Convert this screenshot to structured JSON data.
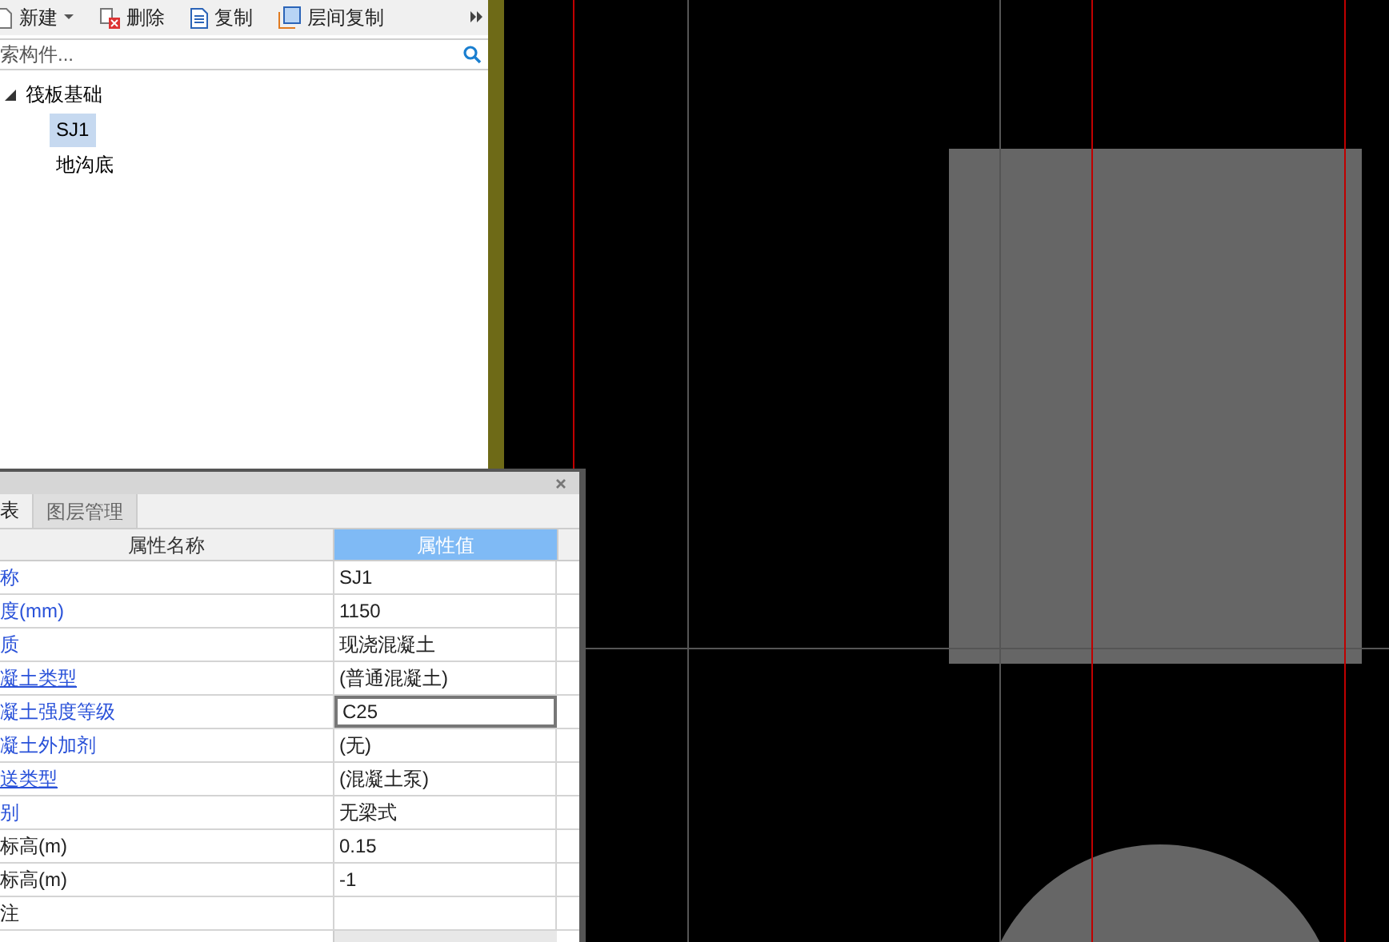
{
  "toolbar": [
    {
      "label": "新建",
      "dropdown": true
    },
    {
      "label": "删除",
      "dropdown": false
    },
    {
      "label": "复制",
      "dropdown": false
    },
    {
      "label": "层间复制",
      "dropdown": false
    }
  ],
  "search": {
    "placeholder": "索构件..."
  },
  "tree": [
    {
      "label": "筏板基础",
      "expanded": true,
      "selected": false,
      "children": [
        {
          "label": "SJ1",
          "selected": true
        },
        {
          "label": "地沟底",
          "selected": false
        }
      ]
    }
  ],
  "properties_panel": {
    "tabs": [
      {
        "label": "表",
        "selected": true
      },
      {
        "label": "图层管理",
        "selected": false
      }
    ],
    "columns": [
      "属性名称",
      "属性值"
    ],
    "rows": [
      {
        "name": "称",
        "value": "SJ1",
        "blue": true,
        "underlined": false,
        "selected": false
      },
      {
        "name": "度(mm)",
        "value": "1150",
        "blue": true,
        "underlined": false,
        "selected": false
      },
      {
        "name": "质",
        "value": "现浇混凝土",
        "blue": true,
        "underlined": false,
        "selected": false
      },
      {
        "name": "凝土类型",
        "value": "(普通混凝土)",
        "blue": true,
        "underlined": true,
        "selected": false
      },
      {
        "name": "凝土强度等级",
        "value": "C25",
        "blue": true,
        "underlined": false,
        "selected": true
      },
      {
        "name": "凝土外加剂",
        "value": "(无)",
        "blue": true,
        "underlined": false,
        "selected": false
      },
      {
        "name": "送类型",
        "value": "(混凝土泵)",
        "blue": true,
        "underlined": true,
        "selected": false
      },
      {
        "name": "别",
        "value": "无梁式",
        "blue": true,
        "underlined": false,
        "selected": false
      },
      {
        "name": "标高(m)",
        "value": "0.15",
        "blue": false,
        "underlined": false,
        "selected": false
      },
      {
        "name": "标高(m)",
        "value": "-1",
        "blue": false,
        "underlined": false,
        "selected": false
      },
      {
        "name": "注",
        "value": "",
        "blue": false,
        "underlined": false,
        "selected": false
      }
    ]
  }
}
